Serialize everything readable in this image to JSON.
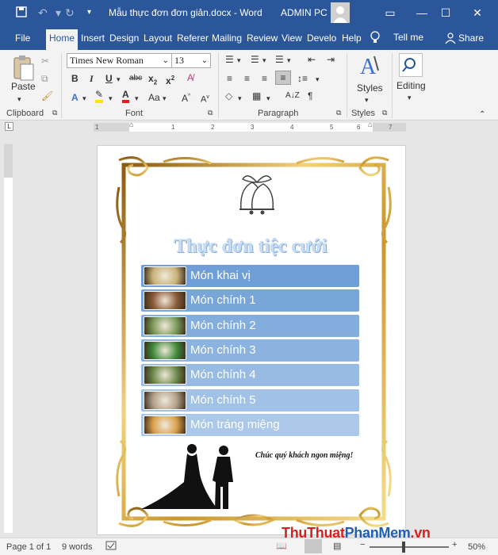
{
  "window": {
    "doc_title": "Mẫu thực đơn đơn giản.docx - Word",
    "user": "ADMIN PC",
    "qat_icons": [
      "save-icon",
      "undo-icon",
      "redo-icon",
      "customize-qat-icon"
    ]
  },
  "tabs": [
    "File",
    "Home",
    "Insert",
    "Design",
    "Layout",
    "Referer",
    "Mailing",
    "Review",
    "View",
    "Develo",
    "Help"
  ],
  "tell_me": "Tell me",
  "share": "Share",
  "ribbon": {
    "clipboard": {
      "label": "Clipboard",
      "paste": "Paste"
    },
    "font": {
      "label": "Font",
      "name": "Times New Roman",
      "size": "13"
    },
    "paragraph": {
      "label": "Paragraph"
    },
    "styles": {
      "label": "Styles",
      "button": "Styles"
    },
    "editing": {
      "button": "Editing"
    }
  },
  "ruler_marks": [
    "1",
    "1",
    "2",
    "3",
    "4",
    "5",
    "6",
    "7"
  ],
  "document": {
    "title": "Thực đơn tiệc cưới",
    "menu_items": [
      {
        "label": "Món khai vị",
        "color": "#6f9fd6",
        "thumb": "#c8b27a"
      },
      {
        "label": "Món chính 1",
        "color": "#78a6d9",
        "thumb": "#8a5a3a"
      },
      {
        "label": "Món chính 2",
        "color": "#83addc",
        "thumb": "#7a9a5a"
      },
      {
        "label": "Món chính 3",
        "color": "#8cb3df",
        "thumb": "#3f8a3a"
      },
      {
        "label": "Món chính 4",
        "color": "#97bbe3",
        "thumb": "#6b8a4a"
      },
      {
        "label": "Món chính 5",
        "color": "#a1c2e6",
        "thumb": "#b0a08a"
      },
      {
        "label": "Món tráng miệng",
        "color": "#abc8e9",
        "thumb": "#d9a04a"
      }
    ],
    "wish": "Chúc quý khách ngon miệng!"
  },
  "status": {
    "page": "Page 1 of 1",
    "words": "9 words",
    "zoom": "50%"
  },
  "watermark": {
    "part1": "ThuThuat",
    "part2": "PhanMem",
    "part3": ".vn"
  },
  "colors": {
    "accent": "#2b579a",
    "gold": "#c9a227"
  }
}
